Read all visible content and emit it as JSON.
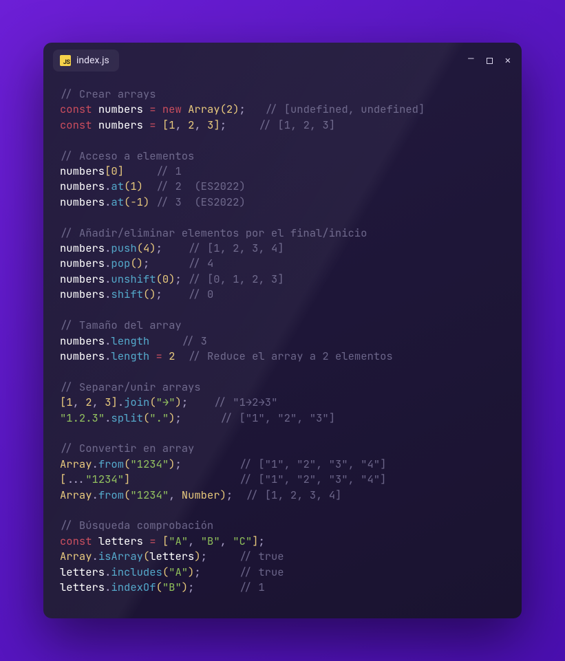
{
  "filename": "index.js",
  "js_badge": "JS",
  "comments": {
    "crear": "// Crear arrays",
    "undef": "// [undefined, undefined]",
    "a123": "// [1, 2, 3]",
    "acceso": "// Acceso a elementos",
    "r1": "// 1",
    "r2es": "// 2  (ES2022)",
    "r3es": "// 3  (ES2022)",
    "addrem": "// Añadir/eliminar elementos por el final/inicio",
    "p1234": "// [1, 2, 3, 4]",
    "p4": "// 4",
    "u0123": "// [0, 1, 2, 3]",
    "s0": "// 0",
    "tam": "// Tamaño del array",
    "l3": "// 3",
    "lred": "// Reduce el array a 2 elementos",
    "sep": "// Separar/unir arrays",
    "jr": "// \"1→2→3\"",
    "sr": "// [\"1\", \"2\", \"3\"]",
    "conv": "// Convertir en array",
    "fr": "// [\"1\", \"2\", \"3\", \"4\"]",
    "fr2": "// [\"1\", \"2\", \"3\", \"4\"]",
    "frn": "// [1, 2, 3, 4]",
    "busq": "// Búsqueda comprobación",
    "tr": "// true",
    "tr2": "// true",
    "i1": "// 1"
  },
  "tokens": {
    "const": "const",
    "new": "new",
    "numbers": "numbers",
    "letters": "letters",
    "Array": "Array",
    "Number": "Number",
    "at": "at",
    "push": "push",
    "pop": "pop",
    "unshift": "unshift",
    "shift": "shift",
    "length": "length",
    "join": "join",
    "split": "split",
    "from": "from",
    "isArray": "isArray",
    "includes": "includes",
    "indexOf": "indexOf"
  },
  "values": {
    "n2": "2",
    "n1": "1",
    "n3": "3",
    "n0": "0",
    "n4": "4",
    "nm1": "-1",
    "arrow": "\"→\"",
    "s123dot": "\"1.2.3\"",
    "dot": "\".\"",
    "s1234": "\"1234\"",
    "A": "\"A\"",
    "B": "\"B\"",
    "C": "\"C\""
  }
}
